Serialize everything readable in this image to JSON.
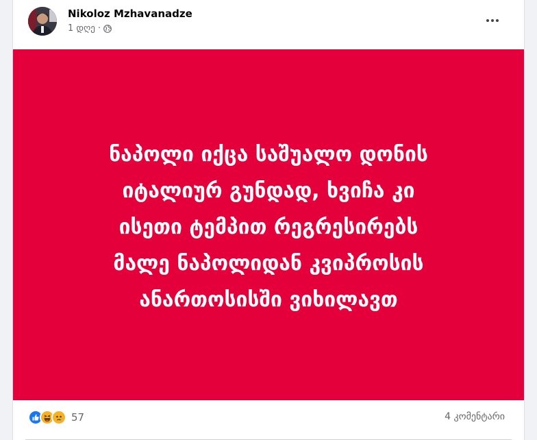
{
  "post": {
    "author": "Nikoloz Mzhavanadze",
    "time": "1 დღე",
    "separator": "·",
    "audience_icon": "globe-icon",
    "menu_icon": "more-options-icon",
    "background_color": "#e4003a",
    "text": "ნაპოლი იქცა საშუალო დონის\nიტალიურ გუნდად, ხვიჩა კი\nისეთი ტემპით რეგრესირებს\nმალე ნაპოლიდან კვიპროსის\nანართოსისში ვიხილავთ",
    "reactions": {
      "icons": [
        "like-icon",
        "haha-icon",
        "sad-icon"
      ],
      "count": "57"
    },
    "comments": "4 კომენტარი"
  }
}
